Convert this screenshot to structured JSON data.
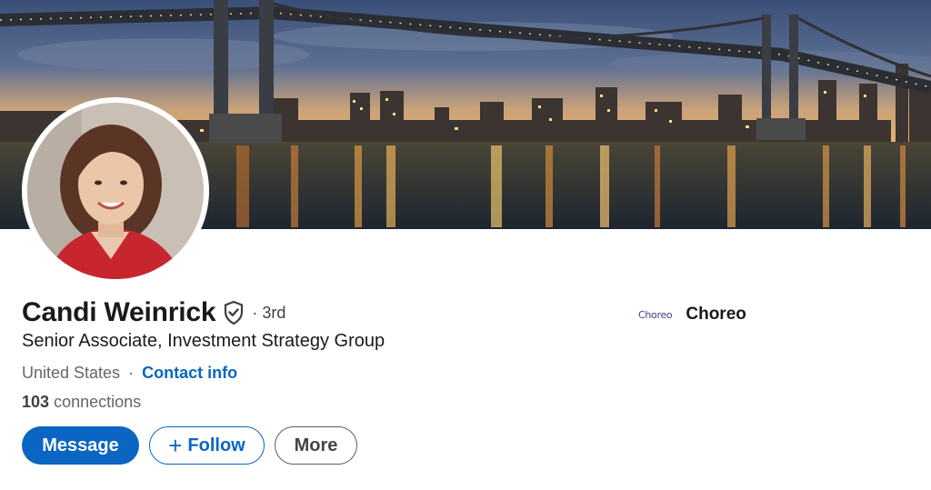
{
  "profile": {
    "name": "Candi Weinrick",
    "degree": "· 3rd",
    "headline": "Senior Associate, Investment Strategy Group",
    "location": "United States",
    "location_separator": "·",
    "contact_label": "Contact info",
    "connections_count": "103",
    "connections_label": "connections"
  },
  "company": {
    "logo_text": "Choreo",
    "name": "Choreo"
  },
  "actions": {
    "message_label": "Message",
    "follow_label": "Follow",
    "more_label": "More"
  },
  "icons": {
    "verified": "shield-check-icon",
    "follow_plus": "plus-icon"
  },
  "colors": {
    "brand_blue": "#0a66c2",
    "text_primary": "#1a1a1a",
    "text_secondary": "#666666"
  }
}
